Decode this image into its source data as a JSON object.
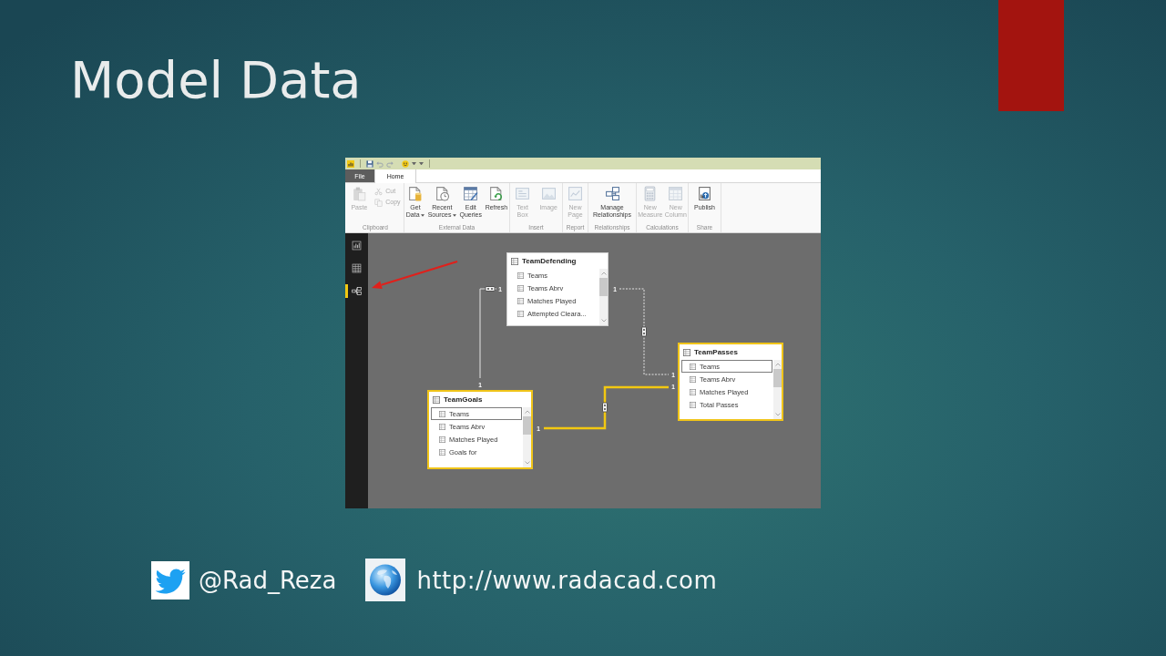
{
  "slide": {
    "title": "Model Data"
  },
  "app": {
    "tabs": [
      {
        "label": "File",
        "kind": "backstage",
        "selected": false
      },
      {
        "label": "Home",
        "kind": "ribbon",
        "selected": true
      }
    ],
    "ribbon": [
      {
        "label": "Clipboard",
        "buttons": [
          {
            "kind": "large",
            "lines": [
              "Paste"
            ],
            "dropdown": false,
            "disabled": true
          },
          {
            "kind": "small",
            "lines": [
              "Cut"
            ],
            "dropdown": false,
            "disabled": true
          },
          {
            "kind": "small",
            "lines": [
              "Copy"
            ],
            "dropdown": false,
            "disabled": true
          }
        ]
      },
      {
        "label": "External Data",
        "buttons": [
          {
            "kind": "large",
            "lines": [
              "Get",
              "Data"
            ],
            "dropdown": true,
            "disabled": false
          },
          {
            "kind": "large",
            "lines": [
              "Recent",
              "Sources"
            ],
            "dropdown": true,
            "disabled": false
          },
          {
            "kind": "large",
            "lines": [
              "Edit",
              "Queries"
            ],
            "dropdown": false,
            "disabled": false
          },
          {
            "kind": "large",
            "lines": [
              "Refresh"
            ],
            "dropdown": false,
            "disabled": false
          }
        ]
      },
      {
        "label": "Insert",
        "buttons": [
          {
            "kind": "large",
            "lines": [
              "Text",
              "Box"
            ],
            "dropdown": false,
            "disabled": true
          },
          {
            "kind": "large",
            "lines": [
              "Image"
            ],
            "dropdown": false,
            "disabled": true
          }
        ]
      },
      {
        "label": "Report",
        "buttons": [
          {
            "kind": "large",
            "lines": [
              "New",
              "Page"
            ],
            "dropdown": false,
            "disabled": true
          }
        ]
      },
      {
        "label": "Relationships",
        "buttons": [
          {
            "kind": "large",
            "lines": [
              "Manage",
              "Relationships"
            ],
            "dropdown": false,
            "disabled": false
          }
        ]
      },
      {
        "label": "Calculations",
        "buttons": [
          {
            "kind": "large",
            "lines": [
              "New",
              "Measure"
            ],
            "dropdown": false,
            "disabled": true
          },
          {
            "kind": "large",
            "lines": [
              "New",
              "Column"
            ],
            "dropdown": false,
            "disabled": true
          }
        ]
      },
      {
        "label": "Share",
        "buttons": [
          {
            "kind": "large",
            "lines": [
              "Publish"
            ],
            "dropdown": false,
            "disabled": false
          }
        ]
      }
    ],
    "views": [
      {
        "selected": false
      },
      {
        "selected": false
      },
      {
        "selected": true
      }
    ],
    "diagram": {
      "tables": [
        {
          "name": "TeamDefending",
          "selected": false,
          "fields": [
            {
              "name": "Teams",
              "selected": false
            },
            {
              "name": "Teams Abrv",
              "selected": false
            },
            {
              "name": "Matches Played",
              "selected": false
            },
            {
              "name": "Attempted Cleara...",
              "selected": false
            }
          ]
        },
        {
          "name": "TeamPasses",
          "selected": true,
          "fields": [
            {
              "name": "Teams",
              "selected": true
            },
            {
              "name": "Teams Abrv",
              "selected": false
            },
            {
              "name": "Matches Played",
              "selected": false
            },
            {
              "name": "Total Passes",
              "selected": false
            }
          ]
        },
        {
          "name": "TeamGoals",
          "selected": true,
          "fields": [
            {
              "name": "Teams",
              "selected": true
            },
            {
              "name": "Teams Abrv",
              "selected": false
            },
            {
              "name": "Matches Played",
              "selected": false
            },
            {
              "name": "Goals for",
              "selected": false
            }
          ]
        }
      ],
      "relationships": [
        {
          "cardinalities": [
            "1",
            "1"
          ],
          "active": true,
          "highlighted": false
        },
        {
          "cardinalities": [
            "1",
            "1"
          ],
          "active": false,
          "highlighted": false
        },
        {
          "cardinalities": [
            "1",
            "1"
          ],
          "active": true,
          "highlighted": true
        }
      ]
    }
  },
  "footer": {
    "twitter_handle": "@Rad_Reza",
    "website": "http://www.radacad.com"
  }
}
